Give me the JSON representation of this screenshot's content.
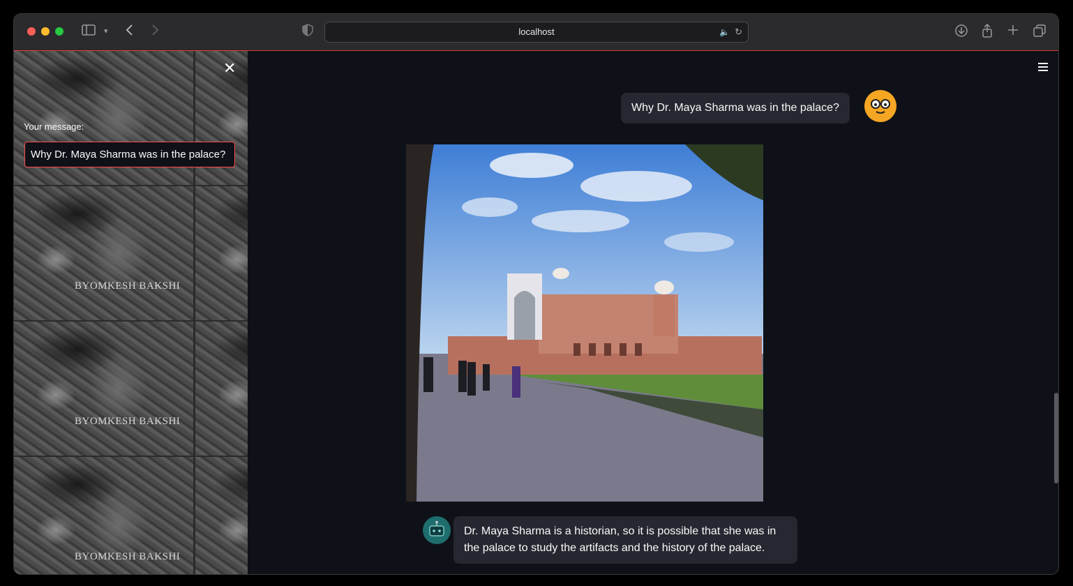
{
  "browser": {
    "url": "localhost"
  },
  "sidebar": {
    "close_icon": "close-icon",
    "message_label": "Your message:",
    "message_value": "Why Dr. Maya Sharma was in the palace?",
    "background_watermark": "BYOMKESH BAKSHI"
  },
  "chat": {
    "user_message": "Why Dr. Maya Sharma was in the palace?",
    "assistant_message": "Dr. Maya Sharma is a historian, so it is possible that she was in the palace to study the artifacts and the history of the palace."
  },
  "colors": {
    "app_background": "#0e1117",
    "bubble": "#262730",
    "input_border": "#ff4b4b",
    "user_avatar": "#f5a623",
    "bot_avatar": "#1f6e6e"
  }
}
